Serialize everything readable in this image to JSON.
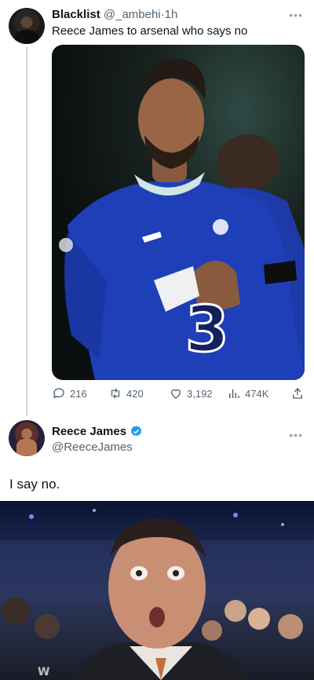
{
  "tweet": {
    "author_name": "Blacklist",
    "author_handle": "@_ambehi",
    "separator": "·",
    "time": "1h",
    "text": "Reece James to arsenal who says no",
    "more_icon": "more-horizontal-icon",
    "image_kind": "football-player-photo",
    "stats": {
      "replies": "216",
      "retweets": "420",
      "likes": "3,192",
      "views": "474K"
    }
  },
  "reply": {
    "author_name": "Reece James",
    "author_handle": "@ReeceJames",
    "verified": true,
    "text": "I say no.",
    "image_kind": "surprised-face-gif"
  },
  "colors": {
    "text_primary": "#0f1419",
    "text_secondary": "#536471",
    "thread_line": "#cfd9de",
    "verified_blue": "#1d9bf0",
    "jersey_blue": "#1f3fb8"
  }
}
